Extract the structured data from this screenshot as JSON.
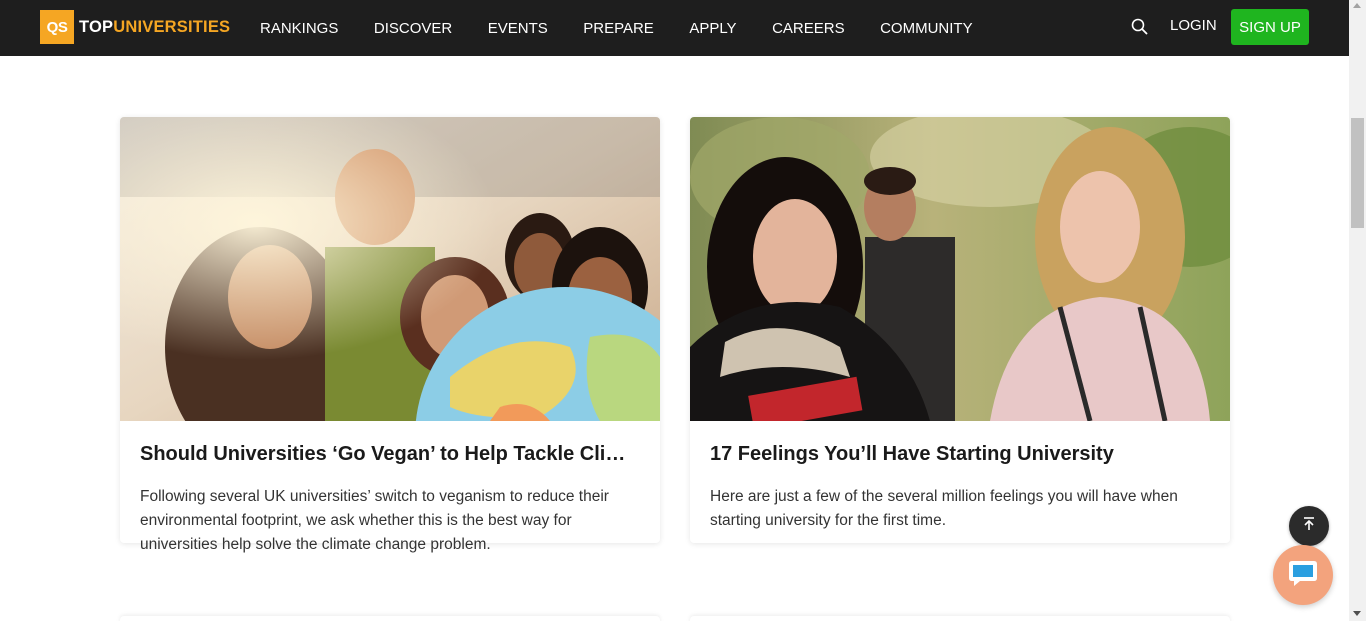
{
  "header": {
    "logo_badge": "QS",
    "logo_top": "TOP",
    "logo_uni": "UNIVERSITIES",
    "nav": [
      "RANKINGS",
      "DISCOVER",
      "EVENTS",
      "PREPARE",
      "APPLY",
      "CAREERS",
      "COMMUNITY"
    ],
    "login_label": "LOGIN",
    "signup_label": "SIGN UP"
  },
  "articles": [
    {
      "title": "Should Universities ‘Go Vegan’ to Help Tackle Climate Change?",
      "description": "Following several UK universities’ switch to veganism to reduce their environmental footprint, we ask whether this is the best way for universities help solve the climate change problem."
    },
    {
      "title": "17 Feelings You’ll Have Starting University",
      "description": "Here are just a few of the several million feelings you will have when starting university for the first time."
    }
  ],
  "colors": {
    "header_bg": "#1e1e1e",
    "brand_orange": "#f5a623",
    "signup_green": "#1fb51f",
    "chat_peach": "#f3a37d"
  },
  "icons": {
    "search": "search-icon",
    "back_to_top": "arrow-up-icon",
    "chat": "chat-bubble-icon"
  }
}
